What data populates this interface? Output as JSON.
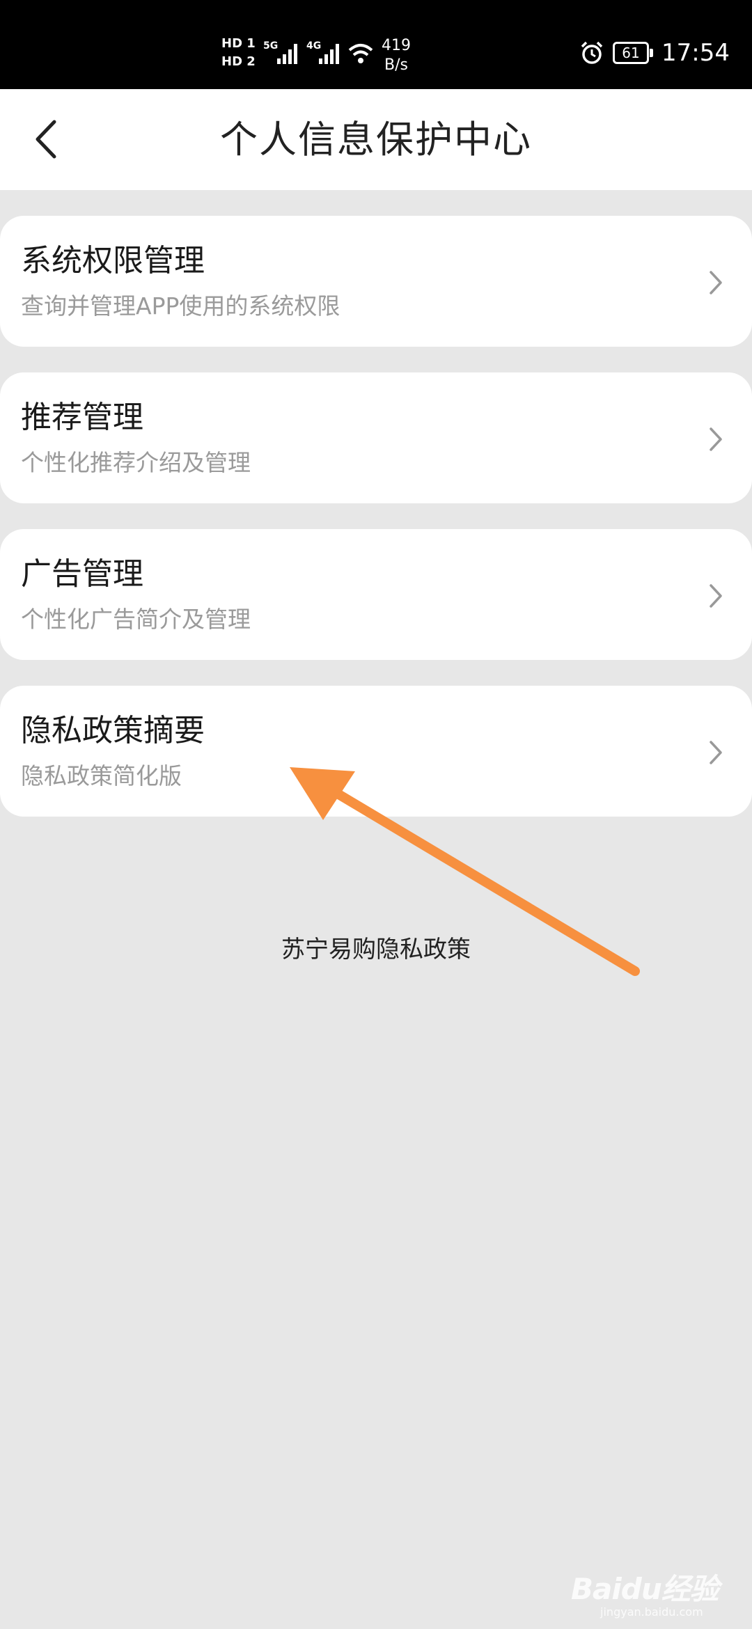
{
  "status_bar": {
    "sim1": "HD 1",
    "sim2": "HD 2",
    "net1": "5G",
    "net2": "4G",
    "speed_value": "419",
    "speed_unit": "B/s",
    "battery": "61",
    "time": "17:54",
    "icons": [
      "signal-icon",
      "wifi-icon",
      "alarm-icon",
      "battery-icon"
    ]
  },
  "header": {
    "title": "个人信息保护中心",
    "back_icon": "chevron-left-icon"
  },
  "menu": {
    "items": [
      {
        "title": "系统权限管理",
        "subtitle": "查询并管理APP使用的系统权限"
      },
      {
        "title": "推荐管理",
        "subtitle": "个性化推荐介绍及管理"
      },
      {
        "title": "广告管理",
        "subtitle": "个性化广告简介及管理"
      },
      {
        "title": "隐私政策摘要",
        "subtitle": "隐私政策简化版"
      }
    ]
  },
  "footer": {
    "policy_link": "苏宁易购隐私政策"
  },
  "annotation": {
    "arrow_color": "#f7903f"
  },
  "watermark": {
    "logo": "Baidu经验",
    "sub": "jingyan.baidu.com"
  },
  "colors": {
    "background": "#e7e7e7",
    "card": "#ffffff",
    "title_text": "#1a1a1a",
    "subtitle_text": "#9a9a9a"
  }
}
